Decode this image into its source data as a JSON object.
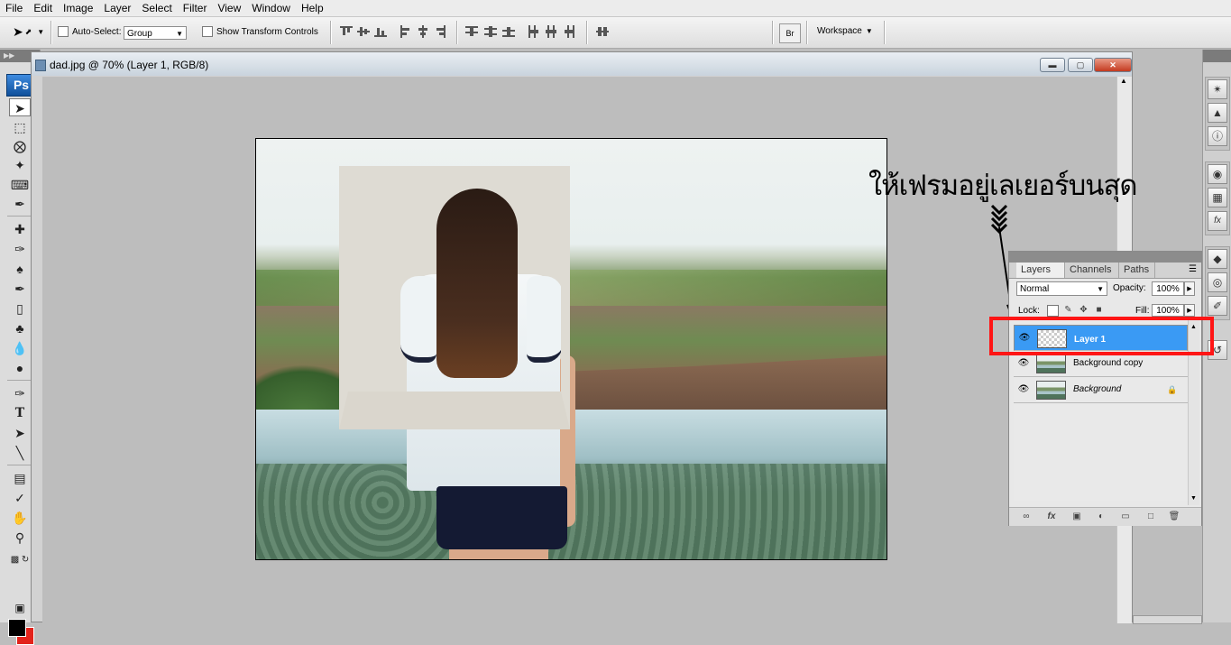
{
  "menu": [
    "File",
    "Edit",
    "Image",
    "Layer",
    "Select",
    "Filter",
    "View",
    "Window",
    "Help"
  ],
  "options_bar": {
    "tool_icon": "move-tool-icon",
    "auto_select_label": "Auto-Select:",
    "auto_select_value": "Group",
    "show_transform_label": "Show Transform Controls",
    "workspace_label": "Workspace"
  },
  "tools": {
    "logo": "Ps",
    "items": [
      "move",
      "marquee",
      "lasso",
      "magic-wand",
      "crop",
      "slice",
      "healing",
      "brush",
      "clone-stamp",
      "history-brush",
      "eraser",
      "paint-bucket",
      "blur",
      "dodge",
      "pen",
      "type",
      "path-select",
      "line",
      "notes",
      "eyedropper",
      "hand",
      "zoom"
    ],
    "type_glyph": "T",
    "foreground_color": "#000000",
    "background_color": "#e3231b"
  },
  "document": {
    "title": "dad.jpg @ 70% (Layer 1, RGB/8)"
  },
  "annotation": {
    "text": "ให้เฟรมอยู่เลเยอร์บนสุด",
    "highlight_color": "#ff1515"
  },
  "layers_panel": {
    "tabs": [
      "Layers",
      "Channels",
      "Paths"
    ],
    "blend_mode": "Normal",
    "opacity_label": "Opacity:",
    "opacity_value": "100%",
    "lock_label": "Lock:",
    "fill_label": "Fill:",
    "fill_value": "100%",
    "layers": [
      {
        "name": "Layer 1",
        "selected": true
      },
      {
        "name": "Background copy",
        "selected": false
      },
      {
        "name": "Background",
        "selected": false,
        "locked": true
      }
    ],
    "footer_icons": [
      "link-icon",
      "fx-icon",
      "mask-icon",
      "adjustment-icon",
      "group-folder-icon",
      "new-layer-icon",
      "trash-icon"
    ]
  },
  "colors": {
    "selection_blue": "#3a9af4",
    "ps_blue": "#1f6fc6"
  }
}
